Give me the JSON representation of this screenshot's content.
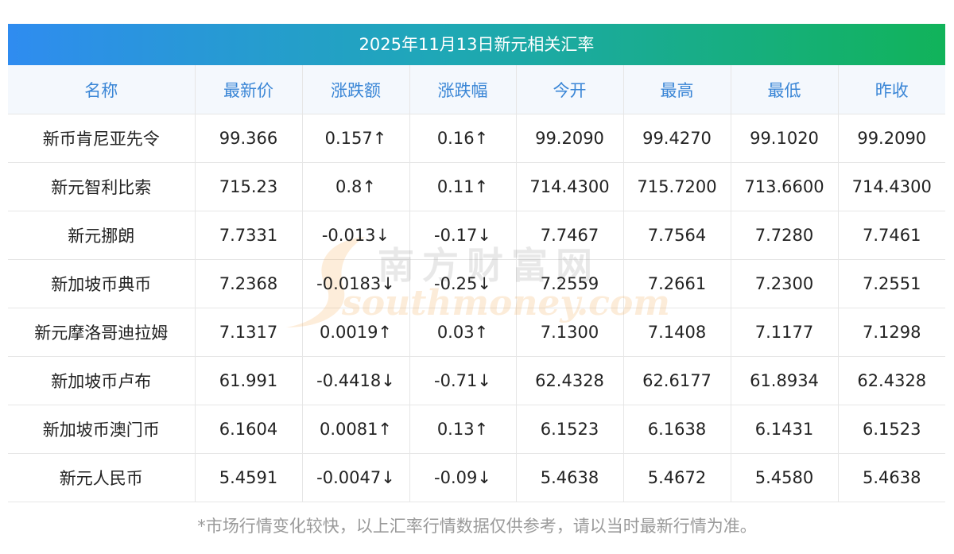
{
  "title": "2025年11月13日新元相关汇率",
  "columns": [
    "名称",
    "最新价",
    "涨跌额",
    "涨跌幅",
    "今开",
    "最高",
    "最低",
    "昨收"
  ],
  "rows": [
    {
      "name": "新币肯尼亚先令",
      "latest": "99.366",
      "change": "0.157↑",
      "pct": "0.16↑",
      "open": "99.2090",
      "high": "99.4270",
      "low": "99.1020",
      "prev": "99.2090",
      "dir": "up"
    },
    {
      "name": "新元智利比索",
      "latest": "715.23",
      "change": "0.8↑",
      "pct": "0.11↑",
      "open": "714.4300",
      "high": "715.7200",
      "low": "713.6600",
      "prev": "714.4300",
      "dir": "up"
    },
    {
      "name": "新元挪朗",
      "latest": "7.7331",
      "change": "-0.013↓",
      "pct": "-0.17↓",
      "open": "7.7467",
      "high": "7.7564",
      "low": "7.7280",
      "prev": "7.7461",
      "dir": "down"
    },
    {
      "name": "新加坡币典币",
      "latest": "7.2368",
      "change": "-0.0183↓",
      "pct": "-0.25↓",
      "open": "7.2559",
      "high": "7.2661",
      "low": "7.2300",
      "prev": "7.2551",
      "dir": "down"
    },
    {
      "name": "新元摩洛哥迪拉姆",
      "latest": "7.1317",
      "change": "0.0019↑",
      "pct": "0.03↑",
      "open": "7.1300",
      "high": "7.1408",
      "low": "7.1177",
      "prev": "7.1298",
      "dir": "up"
    },
    {
      "name": "新加坡币卢布",
      "latest": "61.991",
      "change": "-0.4418↓",
      "pct": "-0.71↓",
      "open": "62.4328",
      "high": "62.6177",
      "low": "61.8934",
      "prev": "62.4328",
      "dir": "down"
    },
    {
      "name": "新加坡币澳门币",
      "latest": "6.1604",
      "change": "0.0081↑",
      "pct": "0.13↑",
      "open": "6.1523",
      "high": "6.1638",
      "low": "6.1431",
      "prev": "6.1523",
      "dir": "up"
    },
    {
      "name": "新元人民币",
      "latest": "5.4591",
      "change": "-0.0047↓",
      "pct": "-0.09↓",
      "open": "5.4638",
      "high": "5.4672",
      "low": "5.4580",
      "prev": "5.4638",
      "dir": "down"
    }
  ],
  "footnote": "*市场行情变化较快，以上汇率行情数据仅供参考，请以当时最新行情为准。",
  "watermark": {
    "cn": "南方财富网",
    "en": "southmoney.com"
  },
  "colors": {
    "up": "#e51c23",
    "down": "#0f8a1e",
    "header_text": "#3a86d6",
    "title_start": "#2f8cf0",
    "title_end": "#11b35a"
  }
}
